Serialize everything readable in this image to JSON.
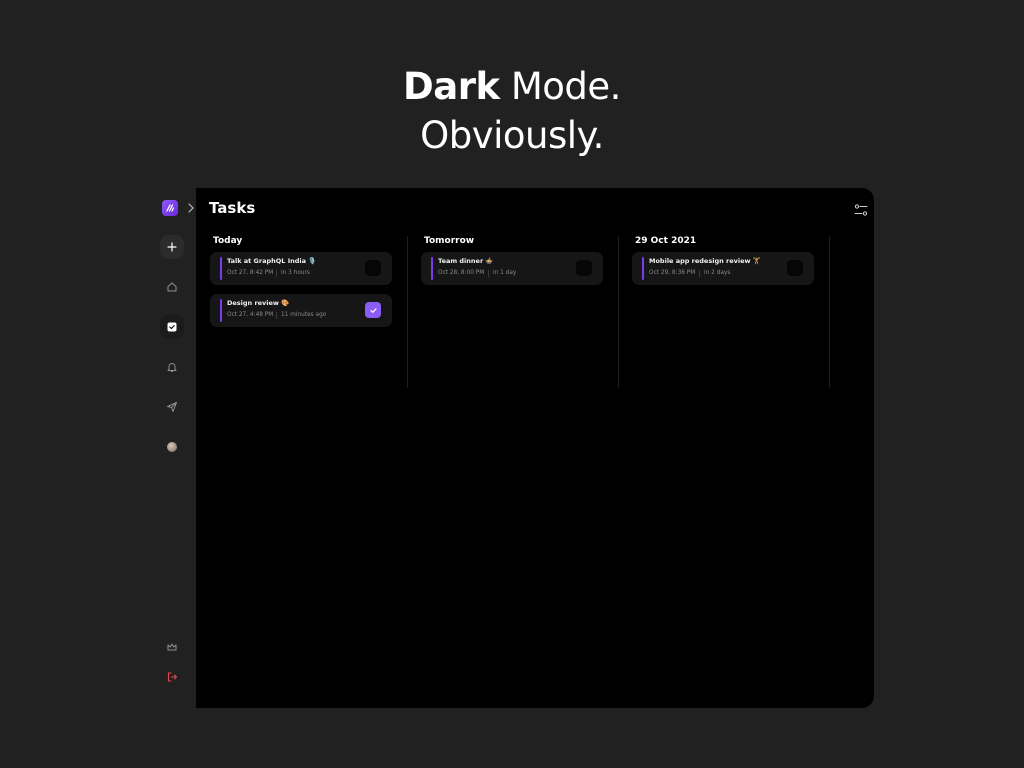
{
  "headline": {
    "bold": "Dark",
    "rest": " Mode.",
    "line2": "Obviously."
  },
  "app": {
    "title": "Tasks",
    "accent_color": "#7c3aed",
    "sidebar_icons": [
      "logo-icon",
      "chevron-right-icon",
      "plus-icon",
      "home-icon",
      "check-square-icon",
      "bell-icon",
      "send-icon",
      "avatar",
      "crown-icon",
      "logout-icon"
    ],
    "columns": [
      {
        "title": "Today",
        "tasks": [
          {
            "title": "Talk at GraphQL India 🎙️",
            "date": "Oct 27, 8:42 PM",
            "relative": "in 3 hours",
            "done": false
          },
          {
            "title": "Design review 🎨",
            "date": "Oct 27, 4:48 PM",
            "relative": "11 minutes ago",
            "done": true
          }
        ]
      },
      {
        "title": "Tomorrow",
        "tasks": [
          {
            "title": "Team dinner 🍲",
            "date": "Oct 28, 8:00 PM",
            "relative": "in 1 day",
            "done": false
          }
        ]
      },
      {
        "title": "29 Oct 2021",
        "tasks": [
          {
            "title": "Mobile app redesign review 🏋️",
            "date": "Oct 29, 8:36 PM",
            "relative": "in 2 days",
            "done": false
          }
        ]
      }
    ]
  }
}
